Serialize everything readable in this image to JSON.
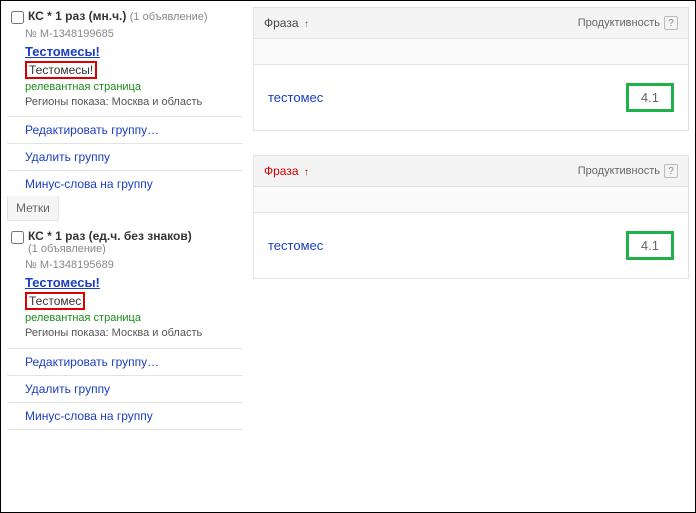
{
  "groups": [
    {
      "title": "КС * 1 раз (мн.ч.)",
      "count": "(1 объявление)",
      "id_label": "№ M-1348199685",
      "ad_title": "Тестомесы!",
      "highlighted": "Тестомесы!",
      "relevant": "релевантная страница",
      "regions": "Регионы показа: Москва и область",
      "actions": {
        "edit": "Редактировать группу…",
        "delete": "Удалить группу",
        "minus": "Минус-слова на группу"
      },
      "tags": "Метки",
      "table": {
        "phrase_label": "Фраза",
        "productivity_label": "Продуктивность",
        "phrase": "тестомес",
        "score": "4.1",
        "red": false
      }
    },
    {
      "title": "КС * 1 раз (ед.ч. без знаков)",
      "count": "(1 объявление)",
      "id_label": "№ M-1348195689",
      "ad_title": "Тестомесы!",
      "highlighted": "Тестомес",
      "relevant": "релевантная страница",
      "regions": "Регионы показа: Москва и область",
      "actions": {
        "edit": "Редактировать группу…",
        "delete": "Удалить группу",
        "minus": "Минус-слова на группу"
      },
      "table": {
        "phrase_label": "Фраза",
        "productivity_label": "Продуктивность",
        "phrase": "тестомес",
        "score": "4.1",
        "red": true
      }
    }
  ],
  "glyphs": {
    "arrow": "↑",
    "q": "?"
  }
}
